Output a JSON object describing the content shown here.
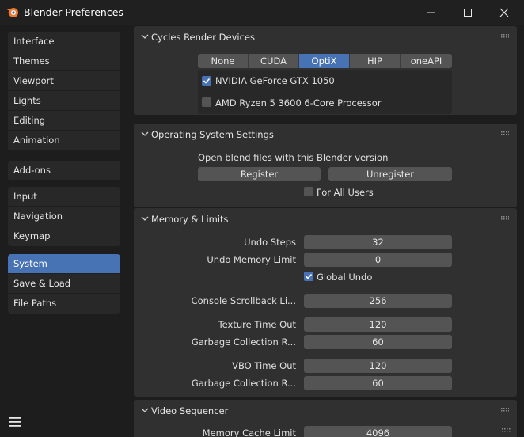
{
  "window": {
    "title": "Blender Preferences"
  },
  "sidebar": {
    "groups": [
      [
        "Interface",
        "Themes",
        "Viewport",
        "Lights",
        "Editing",
        "Animation"
      ],
      [
        "Add-ons"
      ],
      [
        "Input",
        "Navigation",
        "Keymap"
      ],
      [
        "System",
        "Save & Load",
        "File Paths"
      ]
    ],
    "active": "System"
  },
  "cycles": {
    "title": "Cycles Render Devices",
    "tabs": [
      "None",
      "CUDA",
      "OptiX",
      "HIP",
      "oneAPI"
    ],
    "selected_tab": "OptiX",
    "devices": [
      {
        "label": "NVIDIA GeForce GTX 1050",
        "checked": true
      },
      {
        "label": "AMD Ryzen 5 3600 6-Core Processor",
        "checked": false
      }
    ]
  },
  "os": {
    "title": "Operating System Settings",
    "text": "Open blend files with this Blender version",
    "register_label": "Register",
    "unregister_label": "Unregister",
    "all_users_label": "For All Users",
    "all_users_checked": false
  },
  "memory": {
    "title": "Memory & Limits",
    "undo_steps_label": "Undo Steps",
    "undo_steps": "32",
    "undo_memory_label": "Undo Memory Limit",
    "undo_memory": "0",
    "global_undo_label": "Global Undo",
    "global_undo_checked": true,
    "console_label": "Console Scrollback Li...",
    "console_value": "256",
    "texture_timeout_label": "Texture Time Out",
    "texture_timeout": "120",
    "gc_label_1": "Garbage Collection R...",
    "gc_value_1": "60",
    "vbo_timeout_label": "VBO Time Out",
    "vbo_timeout": "120",
    "gc_label_2": "Garbage Collection R...",
    "gc_value_2": "60"
  },
  "sequencer": {
    "title": "Video Sequencer",
    "memory_cache_label": "Memory Cache Limit",
    "memory_cache": "4096"
  },
  "colors": {
    "accent": "#4772b3",
    "panel": "#303030",
    "field": "#545454"
  }
}
